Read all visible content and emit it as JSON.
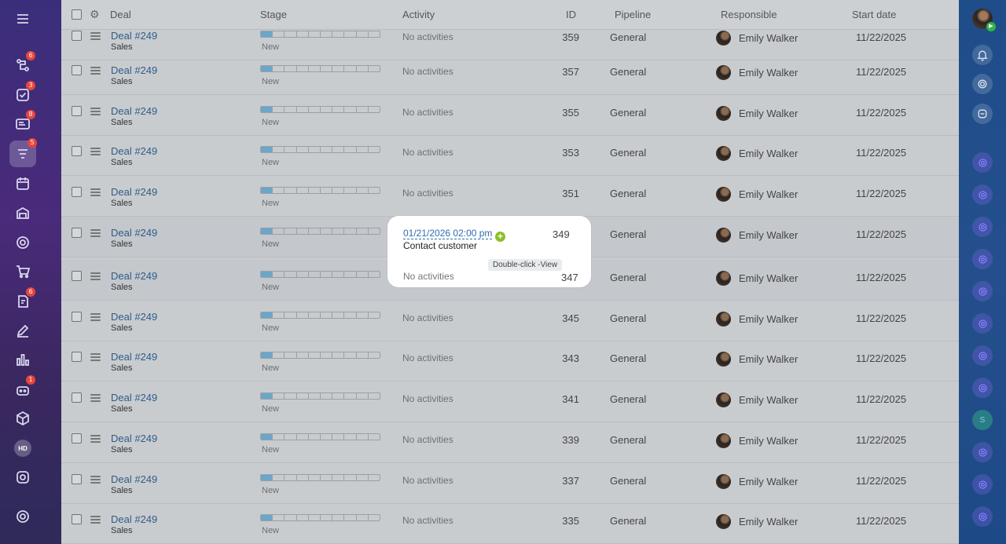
{
  "header": {
    "deal": "Deal",
    "stage": "Stage",
    "activity": "Activity",
    "id": "ID",
    "pipeline": "Pipeline",
    "responsible": "Responsible",
    "start_date": "Start date"
  },
  "rows": [
    {
      "title": "Deal #249",
      "category": "Sales",
      "stage": "New",
      "activity": "No activities",
      "id": "359",
      "pipeline": "General",
      "responsible": "Emily Walker",
      "date": "11/22/2025"
    },
    {
      "title": "Deal #249",
      "category": "Sales",
      "stage": "New",
      "activity": "No activities",
      "id": "357",
      "pipeline": "General",
      "responsible": "Emily Walker",
      "date": "11/22/2025"
    },
    {
      "title": "Deal #249",
      "category": "Sales",
      "stage": "New",
      "activity": "No activities",
      "id": "355",
      "pipeline": "General",
      "responsible": "Emily Walker",
      "date": "11/22/2025"
    },
    {
      "title": "Deal #249",
      "category": "Sales",
      "stage": "New",
      "activity": "No activities",
      "id": "353",
      "pipeline": "General",
      "responsible": "Emily Walker",
      "date": "11/22/2025"
    },
    {
      "title": "Deal #249",
      "category": "Sales",
      "stage": "New",
      "activity": "No activities",
      "id": "351",
      "pipeline": "General",
      "responsible": "Emily Walker",
      "date": "11/22/2025"
    },
    {
      "title": "Deal #249",
      "category": "Sales",
      "stage": "New",
      "activity": "",
      "id": "349",
      "pipeline": "General",
      "responsible": "Emily Walker",
      "date": "11/22/2025"
    },
    {
      "title": "Deal #249",
      "category": "Sales",
      "stage": "New",
      "activity": "",
      "id": "347",
      "pipeline": "General",
      "responsible": "Emily Walker",
      "date": "11/22/2025"
    },
    {
      "title": "Deal #249",
      "category": "Sales",
      "stage": "New",
      "activity": "No activities",
      "id": "345",
      "pipeline": "General",
      "responsible": "Emily Walker",
      "date": "11/22/2025"
    },
    {
      "title": "Deal #249",
      "category": "Sales",
      "stage": "New",
      "activity": "No activities",
      "id": "343",
      "pipeline": "General",
      "responsible": "Emily Walker",
      "date": "11/22/2025"
    },
    {
      "title": "Deal #249",
      "category": "Sales",
      "stage": "New",
      "activity": "No activities",
      "id": "341",
      "pipeline": "General",
      "responsible": "Emily Walker",
      "date": "11/22/2025"
    },
    {
      "title": "Deal #249",
      "category": "Sales",
      "stage": "New",
      "activity": "No activities",
      "id": "339",
      "pipeline": "General",
      "responsible": "Emily Walker",
      "date": "11/22/2025"
    },
    {
      "title": "Deal #249",
      "category": "Sales",
      "stage": "New",
      "activity": "No activities",
      "id": "337",
      "pipeline": "General",
      "responsible": "Emily Walker",
      "date": "11/22/2025"
    },
    {
      "title": "Deal #249",
      "category": "Sales",
      "stage": "New",
      "activity": "No activities",
      "id": "335",
      "pipeline": "General",
      "responsible": "Emily Walker",
      "date": "11/22/2025"
    }
  ],
  "popup": {
    "activity_date": "01/21/2026 02:00 pm",
    "activity_task": "Contact customer",
    "id_first": "349",
    "no_activities": "No activities",
    "id_second": "347",
    "tooltip": "Double-click -View",
    "plus_symbol": "+"
  },
  "left_nav": {
    "badges": {
      "flows": "6",
      "tasks": "3",
      "messages": "8",
      "crm": "5",
      "docs": "6",
      "bot": "1"
    },
    "hd_label": "HD"
  },
  "right_bar": {
    "s_label": "S"
  },
  "colors": {
    "link": "#2e5c8a",
    "stage_fill": "#6aa7c9",
    "badge": "#e8453c",
    "online": "#2fb34a",
    "plus": "#8cbf26"
  }
}
